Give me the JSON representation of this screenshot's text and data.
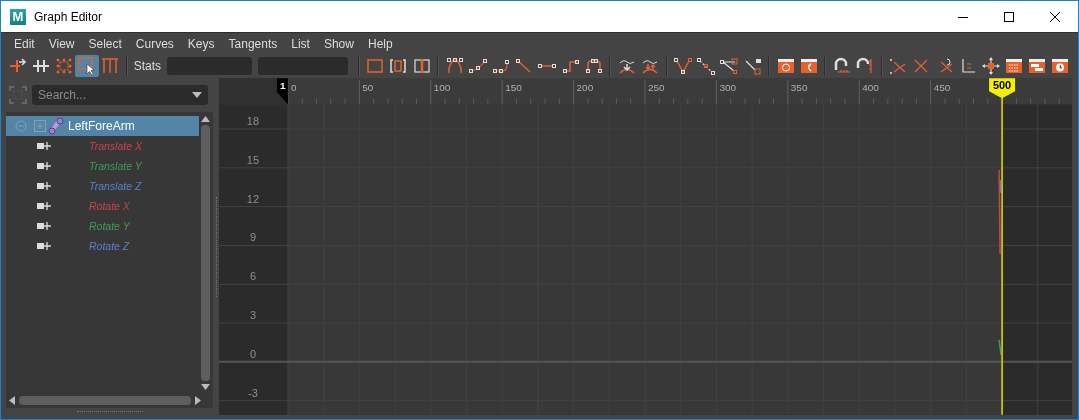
{
  "window": {
    "title": "Graph Editor",
    "logo": "M"
  },
  "menu": [
    "Edit",
    "View",
    "Select",
    "Curves",
    "Keys",
    "Tangents",
    "List",
    "Show",
    "Help"
  ],
  "toolbar": {
    "tools": [
      {
        "selected": false
      },
      {
        "selected": false
      },
      {
        "selected": false
      },
      {
        "selected": true
      },
      {
        "selected": false
      }
    ],
    "stats_label": "Stats"
  },
  "outliner": {
    "search": {
      "placeholder": "Search..."
    },
    "items": [
      {
        "label": "LeftForeArm",
        "selected": true,
        "expanded": true,
        "children": [
          {
            "label": "Translate X",
            "color": "#c8434f",
            "selected": false
          },
          {
            "label": "Translate Y",
            "color": "#3f9c55",
            "selected": false
          },
          {
            "label": "Translate Z",
            "color": "#5b7fcf",
            "selected": false
          },
          {
            "label": "Rotate X",
            "color": "#c8434f",
            "selected": false
          },
          {
            "label": "Rotate Y",
            "color": "#3f9c55",
            "selected": false
          },
          {
            "label": "Rotate Z",
            "color": "#5b7fcf",
            "selected": false
          }
        ]
      }
    ]
  },
  "graph": {
    "ruler_labels": [
      "0",
      "50",
      "100",
      "150",
      "200",
      "250",
      "300",
      "350",
      "400",
      "450"
    ],
    "start_frame": "1",
    "current_frame": "500",
    "y_labels": [
      "18",
      "15",
      "12",
      "9",
      "6",
      "3",
      "0",
      "-3"
    ]
  }
}
